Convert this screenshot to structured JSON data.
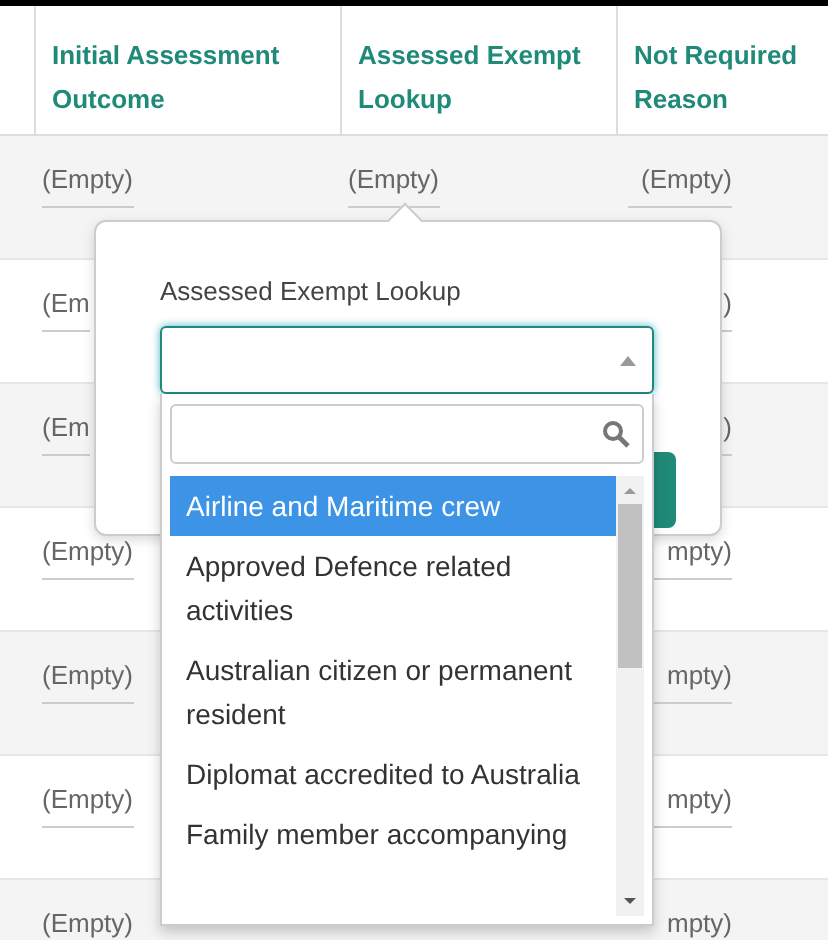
{
  "table": {
    "columns": [
      "Initial Assessment Outcome",
      "Assessed Exempt Lookup",
      "Not Required Reason"
    ],
    "rows": [
      {
        "cells": [
          "(Empty)",
          "(Empty)",
          "(Empty)"
        ]
      },
      {
        "cells": [
          "(Em",
          null,
          ")"
        ]
      },
      {
        "cells": [
          "(Em",
          null,
          ")"
        ]
      },
      {
        "cells": [
          "(Empty)",
          null,
          "mpty)"
        ]
      },
      {
        "cells": [
          "(Empty)",
          null,
          "mpty)"
        ]
      },
      {
        "cells": [
          "(Empty)",
          null,
          "mpty)"
        ]
      },
      {
        "cells": [
          "(Empty)",
          null,
          "mpty)"
        ]
      }
    ]
  },
  "popover": {
    "label": "Assessed Exempt Lookup",
    "options": [
      {
        "label": "Airline and Maritime crew",
        "selected": true
      },
      {
        "label": "Approved Defence related activities",
        "selected": false
      },
      {
        "label": "Australian citizen or permanent resident",
        "selected": false
      },
      {
        "label": "Diplomat accredited to Australia",
        "selected": false
      },
      {
        "label": "Family member accompanying",
        "selected": false
      }
    ]
  }
}
